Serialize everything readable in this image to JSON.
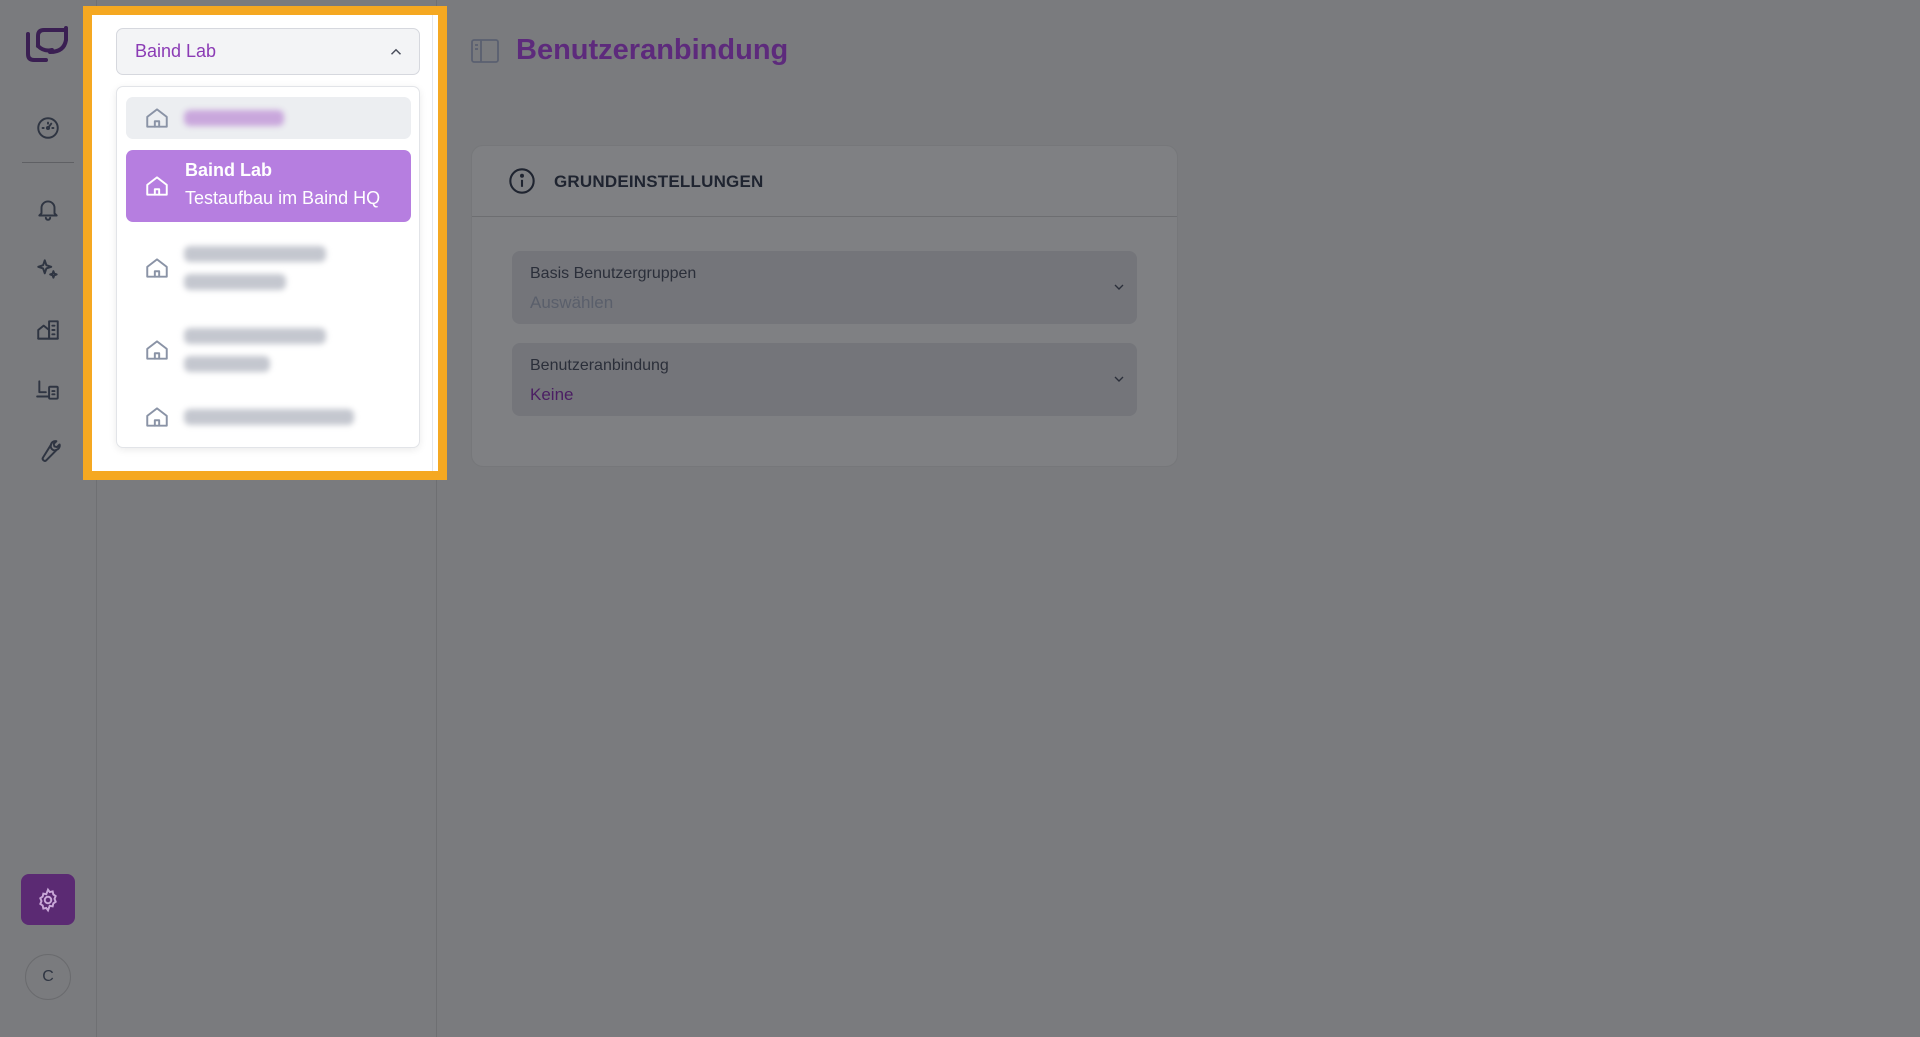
{
  "rail": {
    "avatar_initial": "C"
  },
  "switcher": {
    "selected_label": "Baind Lab",
    "active_item": {
      "name": "Baind Lab",
      "description": "Testaufbau im Baind HQ"
    }
  },
  "page": {
    "title": "Benutzeranbindung"
  },
  "card": {
    "title": "GRUNDEINSTELLUNGEN",
    "fields": [
      {
        "label": "Basis Benutzergruppen",
        "value": "Auswählen"
      },
      {
        "label": "Benutzeranbindung",
        "value": "Keine"
      }
    ]
  },
  "colors": {
    "accent_purple": "#5d2a7c",
    "highlight": "#f5a821",
    "active_item": "#b67ee0",
    "placeholder": "#5a5f6b",
    "value_purple": "#4b1e63"
  }
}
